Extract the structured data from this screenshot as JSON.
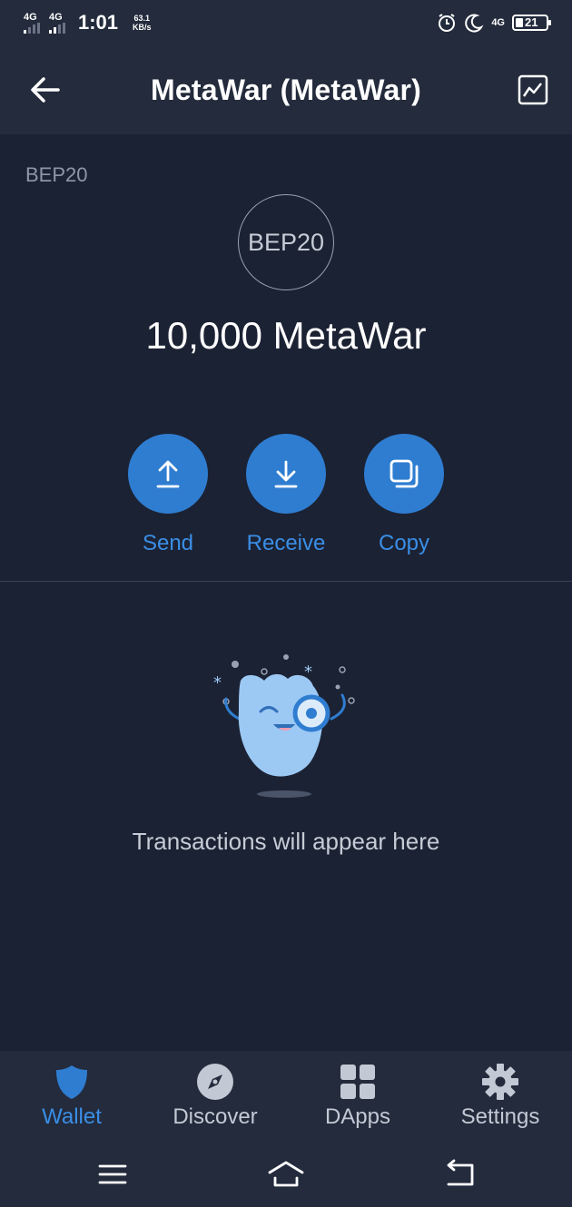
{
  "status_bar": {
    "sim1": "4G",
    "sim2": "4G",
    "time": "1:01",
    "speed_value": "63.1",
    "speed_unit": "KB/s",
    "data_label": "4G",
    "battery": "21"
  },
  "header": {
    "title": "MetaWar (MetaWar)",
    "back_icon": "arrow-left-icon",
    "chart_icon": "chart-icon"
  },
  "token": {
    "network": "BEP20",
    "logo_text": "BEP20",
    "balance": "10,000 MetaWar"
  },
  "actions": [
    {
      "label": "Send",
      "icon": "upload-arrow-icon"
    },
    {
      "label": "Receive",
      "icon": "download-arrow-icon"
    },
    {
      "label": "Copy",
      "icon": "copy-icon"
    }
  ],
  "empty_state": {
    "message": "Transactions will appear here"
  },
  "bottom_nav": [
    {
      "label": "Wallet",
      "icon": "shield-icon",
      "active": true
    },
    {
      "label": "Discover",
      "icon": "compass-icon",
      "active": false
    },
    {
      "label": "DApps",
      "icon": "grid-icon",
      "active": false
    },
    {
      "label": "Settings",
      "icon": "gear-icon",
      "active": false
    }
  ],
  "colors": {
    "background": "#1b2233",
    "bar": "#232b3c",
    "accent": "#2f7dd1",
    "accent_text": "#3a8ee6"
  }
}
